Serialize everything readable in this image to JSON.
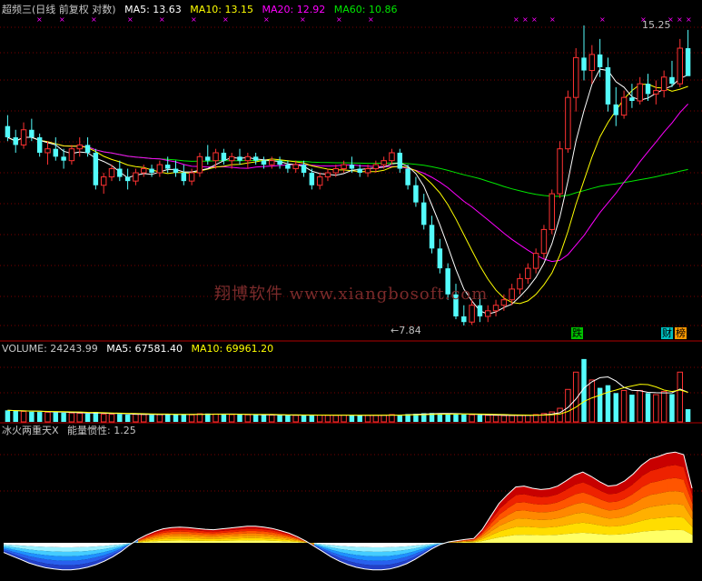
{
  "header_main": {
    "title": "超频三(日线 前复权 对数)",
    "ma5": "MA5: 13.63",
    "ma10": "MA10: 13.15",
    "ma20": "MA20: 12.92",
    "ma60": "MA60: 10.86"
  },
  "header_volume": {
    "volume": "VOLUME: 24243.99",
    "ma5": "MA5: 67581.40",
    "ma10": "MA10: 69961.20"
  },
  "header_indicator": {
    "name": "冰火两重天X",
    "value": "能量惯性: 1.25"
  },
  "annotations": {
    "high": "15.25",
    "low": "←7.84",
    "watermark": "翔博软件 www.xiangbosoft.com",
    "tag_fall": "跌",
    "tag_finance": "财",
    "tag_list": "榜"
  },
  "colors": {
    "up": "#ff3232",
    "down": "#54fcfc",
    "ma5": "#ffffff",
    "ma10": "#ffff00",
    "ma20": "#ff00ff",
    "ma60": "#00e600",
    "grid": "#7a0000"
  },
  "chart_data": [
    {
      "type": "candlestick",
      "scale": "log",
      "title": "超频三(日线 前复权 对数)",
      "ohlc": [
        [
          12.2,
          12.5,
          11.8,
          11.9
        ],
        [
          11.9,
          12.1,
          11.5,
          11.7
        ],
        [
          11.7,
          12.3,
          11.6,
          12.1
        ],
        [
          12.1,
          12.4,
          11.8,
          11.9
        ],
        [
          11.9,
          12.0,
          11.4,
          11.5
        ],
        [
          11.5,
          11.8,
          11.2,
          11.6
        ],
        [
          11.6,
          11.9,
          11.3,
          11.4
        ],
        [
          11.4,
          11.6,
          11.1,
          11.3
        ],
        [
          11.3,
          11.7,
          11.2,
          11.6
        ],
        [
          11.6,
          11.9,
          11.4,
          11.7
        ],
        [
          11.7,
          11.9,
          11.4,
          11.5
        ],
        [
          11.5,
          11.6,
          10.6,
          10.7
        ],
        [
          10.7,
          11.0,
          10.5,
          10.9
        ],
        [
          10.9,
          11.2,
          10.8,
          11.1
        ],
        [
          11.1,
          11.3,
          10.8,
          10.9
        ],
        [
          10.9,
          11.1,
          10.6,
          10.8
        ],
        [
          10.8,
          11.1,
          10.7,
          11.0
        ],
        [
          11.0,
          11.2,
          10.9,
          11.1
        ],
        [
          11.1,
          11.2,
          10.9,
          11.0
        ],
        [
          11.0,
          11.3,
          10.9,
          11.2
        ],
        [
          11.2,
          11.4,
          11.0,
          11.1
        ],
        [
          11.1,
          11.3,
          10.9,
          11.0
        ],
        [
          11.0,
          11.2,
          10.7,
          10.8
        ],
        [
          10.8,
          11.1,
          10.7,
          11.0
        ],
        [
          11.0,
          11.5,
          10.9,
          11.4
        ],
        [
          11.4,
          11.7,
          11.2,
          11.3
        ],
        [
          11.3,
          11.6,
          11.1,
          11.5
        ],
        [
          11.5,
          11.6,
          11.2,
          11.3
        ],
        [
          11.3,
          11.5,
          11.1,
          11.4
        ],
        [
          11.4,
          11.6,
          11.2,
          11.3
        ],
        [
          11.3,
          11.5,
          11.1,
          11.4
        ],
        [
          11.4,
          11.5,
          11.2,
          11.3
        ],
        [
          11.3,
          11.4,
          11.1,
          11.2
        ],
        [
          11.2,
          11.4,
          11.1,
          11.3
        ],
        [
          11.3,
          11.4,
          11.1,
          11.2
        ],
        [
          11.2,
          11.3,
          11.0,
          11.1
        ],
        [
          11.1,
          11.3,
          11.0,
          11.2
        ],
        [
          11.2,
          11.3,
          10.9,
          11.0
        ],
        [
          11.0,
          11.1,
          10.6,
          10.7
        ],
        [
          10.7,
          11.0,
          10.6,
          10.9
        ],
        [
          10.9,
          11.1,
          10.8,
          11.0
        ],
        [
          11.0,
          11.2,
          10.9,
          11.1
        ],
        [
          11.1,
          11.3,
          11.0,
          11.2
        ],
        [
          11.2,
          11.4,
          11.0,
          11.1
        ],
        [
          11.1,
          11.2,
          10.9,
          11.0
        ],
        [
          11.0,
          11.2,
          10.9,
          11.1
        ],
        [
          11.1,
          11.3,
          11.0,
          11.2
        ],
        [
          11.2,
          11.4,
          11.1,
          11.3
        ],
        [
          11.3,
          11.6,
          11.2,
          11.5
        ],
        [
          11.5,
          11.6,
          11.0,
          11.1
        ],
        [
          11.1,
          11.2,
          10.6,
          10.7
        ],
        [
          10.7,
          10.9,
          10.2,
          10.3
        ],
        [
          10.3,
          10.5,
          9.7,
          9.8
        ],
        [
          9.8,
          10.0,
          9.2,
          9.3
        ],
        [
          9.3,
          9.5,
          8.8,
          8.9
        ],
        [
          8.9,
          9.0,
          8.3,
          8.4
        ],
        [
          8.4,
          8.6,
          7.95,
          8.0
        ],
        [
          8.0,
          8.2,
          7.84,
          7.9
        ],
        [
          7.9,
          8.3,
          7.85,
          8.2
        ],
        [
          8.2,
          8.4,
          7.9,
          8.0
        ],
        [
          8.0,
          8.2,
          7.9,
          8.1
        ],
        [
          8.1,
          8.3,
          8.0,
          8.2
        ],
        [
          8.2,
          8.4,
          8.1,
          8.3
        ],
        [
          8.3,
          8.6,
          8.2,
          8.5
        ],
        [
          8.5,
          8.8,
          8.4,
          8.7
        ],
        [
          8.7,
          9.0,
          8.6,
          8.9
        ],
        [
          8.9,
          9.3,
          8.8,
          9.2
        ],
        [
          9.2,
          9.8,
          9.1,
          9.7
        ],
        [
          9.7,
          10.6,
          9.6,
          10.5
        ],
        [
          10.5,
          11.8,
          10.4,
          11.6
        ],
        [
          11.6,
          13.2,
          11.5,
          13.0
        ],
        [
          13.0,
          14.5,
          12.6,
          14.2
        ],
        [
          14.2,
          15.25,
          13.5,
          13.8
        ],
        [
          13.8,
          14.6,
          13.4,
          14.3
        ],
        [
          14.3,
          14.8,
          13.6,
          13.9
        ],
        [
          13.9,
          14.2,
          12.6,
          12.8
        ],
        [
          12.8,
          13.3,
          12.2,
          12.5
        ],
        [
          12.5,
          13.2,
          12.4,
          13.0
        ],
        [
          13.0,
          13.4,
          12.7,
          12.9
        ],
        [
          12.9,
          13.6,
          12.8,
          13.4
        ],
        [
          13.4,
          13.7,
          12.9,
          13.1
        ],
        [
          13.1,
          13.5,
          12.8,
          13.2
        ],
        [
          13.2,
          13.8,
          13.0,
          13.6
        ],
        [
          13.6,
          14.1,
          13.3,
          13.4
        ],
        [
          13.4,
          14.8,
          13.3,
          14.5
        ],
        [
          14.5,
          15.1,
          13.9,
          13.63
        ]
      ],
      "ma_series": [
        {
          "name": "MA5",
          "last": 13.63
        },
        {
          "name": "MA10",
          "last": 13.15
        },
        {
          "name": "MA20",
          "last": 12.92
        },
        {
          "name": "MA60",
          "last": 10.86
        }
      ],
      "annotations": {
        "high": 15.25,
        "low": 7.84
      }
    },
    {
      "type": "bar",
      "title": "VOLUME: 24243.99",
      "series": [
        {
          "name": "VOLUME",
          "values": [
            22000,
            21000,
            20000,
            19500,
            19000,
            18500,
            18000,
            17500,
            17000,
            16500,
            16000,
            19000,
            15000,
            14500,
            15000,
            14000,
            14500,
            14000,
            13500,
            14000,
            15000,
            14500,
            14000,
            13500,
            15500,
            16000,
            15000,
            14500,
            14000,
            14000,
            13500,
            13500,
            13000,
            13000,
            13000,
            12500,
            12500,
            13000,
            13500,
            13000,
            12500,
            12500,
            13000,
            13000,
            12500,
            12500,
            12500,
            13000,
            14000,
            13500,
            15000,
            15500,
            16500,
            17000,
            16000,
            15000,
            14500,
            14000,
            13500,
            13000,
            12500,
            12500,
            12000,
            12000,
            12500,
            13000,
            14000,
            16000,
            19000,
            26000,
            62000,
            95000,
            120000,
            80000,
            65000,
            70000,
            55000,
            60000,
            52000,
            60000,
            55000,
            52000,
            58000,
            53000,
            95000,
            24243.99
          ]
        },
        {
          "name": "MA5",
          "last": 67581.4
        },
        {
          "name": "MA10",
          "last": 69961.2
        }
      ]
    },
    {
      "type": "area",
      "title": "冰火两重天X",
      "series": [
        {
          "name": "能量惯性",
          "values": [
            -0.22,
            -0.3,
            -0.38,
            -0.46,
            -0.52,
            -0.57,
            -0.6,
            -0.62,
            -0.62,
            -0.6,
            -0.56,
            -0.5,
            -0.42,
            -0.32,
            -0.2,
            -0.05,
            0.08,
            0.18,
            0.26,
            0.32,
            0.35,
            0.36,
            0.35,
            0.33,
            0.31,
            0.3,
            0.32,
            0.34,
            0.36,
            0.38,
            0.38,
            0.36,
            0.33,
            0.28,
            0.22,
            0.14,
            0.04,
            -0.08,
            -0.2,
            -0.32,
            -0.42,
            -0.5,
            -0.56,
            -0.6,
            -0.62,
            -0.62,
            -0.6,
            -0.55,
            -0.48,
            -0.38,
            -0.26,
            -0.14,
            -0.04,
            0.02,
            0.05,
            0.08,
            0.1,
            0.3,
            0.6,
            0.9,
            1.1,
            1.28,
            1.3,
            1.25,
            1.22,
            1.24,
            1.3,
            1.42,
            1.55,
            1.62,
            1.52,
            1.4,
            1.3,
            1.32,
            1.42,
            1.58,
            1.78,
            1.92,
            1.98,
            2.05,
            2.08,
            2.02,
            1.25
          ]
        }
      ]
    }
  ]
}
